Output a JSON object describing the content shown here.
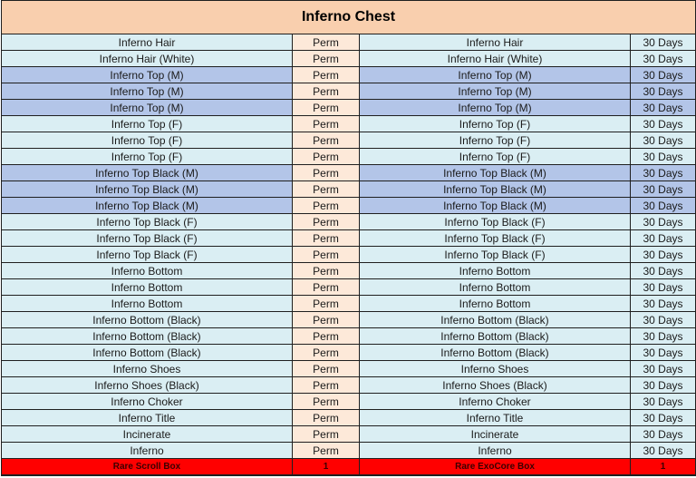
{
  "title": "Inferno Chest",
  "rows": [
    {
      "left": "Inferno Hair",
      "left_dur": "Perm",
      "right": "Inferno Hair",
      "right_dur": "30 Days",
      "highlight": false
    },
    {
      "left": "Inferno Hair (White)",
      "left_dur": "Perm",
      "right": "Inferno Hair (White)",
      "right_dur": "30 Days",
      "highlight": false
    },
    {
      "left": "Inferno Top (M)",
      "left_dur": "Perm",
      "right": "Inferno Top (M)",
      "right_dur": "30 Days",
      "highlight": true
    },
    {
      "left": "Inferno Top (M)",
      "left_dur": "Perm",
      "right": "Inferno Top (M)",
      "right_dur": "30 Days",
      "highlight": true
    },
    {
      "left": "Inferno Top (M)",
      "left_dur": "Perm",
      "right": "Inferno Top (M)",
      "right_dur": "30 Days",
      "highlight": true
    },
    {
      "left": "Inferno Top (F)",
      "left_dur": "Perm",
      "right": "Inferno Top (F)",
      "right_dur": "30 Days",
      "highlight": false
    },
    {
      "left": "Inferno Top (F)",
      "left_dur": "Perm",
      "right": "Inferno Top (F)",
      "right_dur": "30 Days",
      "highlight": false
    },
    {
      "left": "Inferno Top (F)",
      "left_dur": "Perm",
      "right": "Inferno Top (F)",
      "right_dur": "30 Days",
      "highlight": false
    },
    {
      "left": "Inferno Top Black (M)",
      "left_dur": "Perm",
      "right": "Inferno Top Black (M)",
      "right_dur": "30 Days",
      "highlight": true
    },
    {
      "left": "Inferno Top Black (M)",
      "left_dur": "Perm",
      "right": "Inferno Top Black (M)",
      "right_dur": "30 Days",
      "highlight": true
    },
    {
      "left": "Inferno Top Black (M)",
      "left_dur": "Perm",
      "right": "Inferno Top Black (M)",
      "right_dur": "30 Days",
      "highlight": true
    },
    {
      "left": "Inferno Top Black (F)",
      "left_dur": "Perm",
      "right": "Inferno Top Black (F)",
      "right_dur": "30 Days",
      "highlight": false
    },
    {
      "left": "Inferno Top Black (F)",
      "left_dur": "Perm",
      "right": "Inferno Top Black (F)",
      "right_dur": "30 Days",
      "highlight": false
    },
    {
      "left": "Inferno Top Black (F)",
      "left_dur": "Perm",
      "right": "Inferno Top Black (F)",
      "right_dur": "30 Days",
      "highlight": false
    },
    {
      "left": "Inferno Bottom",
      "left_dur": "Perm",
      "right": "Inferno Bottom",
      "right_dur": "30 Days",
      "highlight": false
    },
    {
      "left": "Inferno Bottom",
      "left_dur": "Perm",
      "right": "Inferno Bottom",
      "right_dur": "30 Days",
      "highlight": false
    },
    {
      "left": "Inferno Bottom",
      "left_dur": "Perm",
      "right": "Inferno Bottom",
      "right_dur": "30 Days",
      "highlight": false
    },
    {
      "left": "Inferno Bottom (Black)",
      "left_dur": "Perm",
      "right": "Inferno Bottom (Black)",
      "right_dur": "30 Days",
      "highlight": false
    },
    {
      "left": "Inferno Bottom (Black)",
      "left_dur": "Perm",
      "right": "Inferno Bottom (Black)",
      "right_dur": "30 Days",
      "highlight": false
    },
    {
      "left": "Inferno Bottom (Black)",
      "left_dur": "Perm",
      "right": "Inferno Bottom (Black)",
      "right_dur": "30 Days",
      "highlight": false
    },
    {
      "left": "Inferno Shoes",
      "left_dur": "Perm",
      "right": "Inferno Shoes",
      "right_dur": "30 Days",
      "highlight": false
    },
    {
      "left": "Inferno Shoes (Black)",
      "left_dur": "Perm",
      "right": "Inferno Shoes (Black)",
      "right_dur": "30 Days",
      "highlight": false
    },
    {
      "left": "Inferno Choker",
      "left_dur": "Perm",
      "right": "Inferno Choker",
      "right_dur": "30 Days",
      "highlight": false
    },
    {
      "left": "Inferno Title",
      "left_dur": "Perm",
      "right": "Inferno Title",
      "right_dur": "30 Days",
      "highlight": false
    },
    {
      "left": "Incinerate",
      "left_dur": "Perm",
      "right": "Incinerate",
      "right_dur": "30 Days",
      "highlight": false
    },
    {
      "left": "Inferno",
      "left_dur": "Perm",
      "right": "Inferno",
      "right_dur": "30 Days",
      "highlight": false
    }
  ],
  "footer": {
    "left": "Rare Scroll Box",
    "left_qty": "1",
    "right": "Rare ExoCore Box",
    "right_qty": "1"
  },
  "colors": {
    "title_bg": "#f9cfae",
    "name_bg": "#daeef3",
    "perm_bg": "#fde9d9",
    "highlight_bg": "#b3c5e8",
    "footer_bg": "#ff0000"
  }
}
